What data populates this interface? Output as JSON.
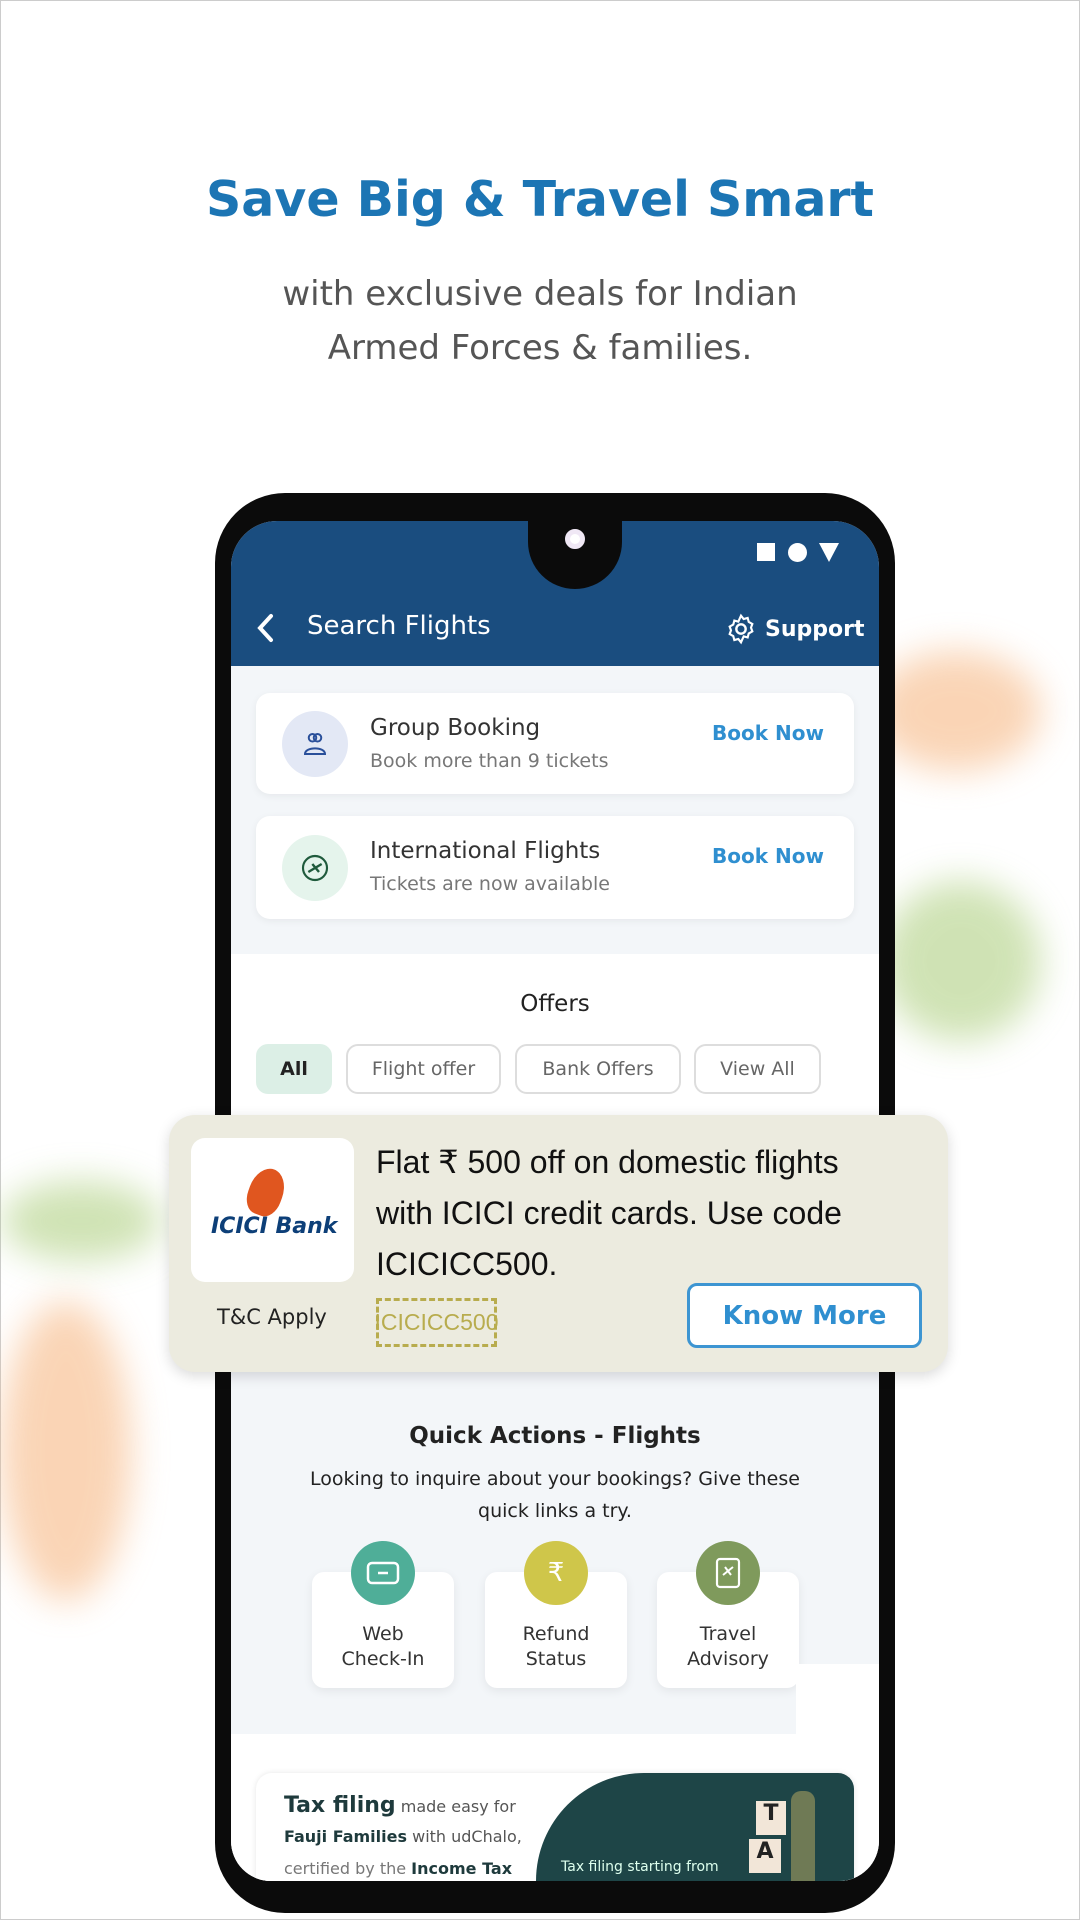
{
  "hero": {
    "title": "Save Big & Travel Smart",
    "subtitle_line1": "with exclusive deals for Indian",
    "subtitle_line2": "Armed Forces & families."
  },
  "colors": {
    "accent": "#1c75b4",
    "header": "#1a4d7f",
    "link": "#2f8fd0",
    "offer_bg": "#ecebdf",
    "code": "#b8ac4e"
  },
  "header": {
    "back_icon": "chevron-left-icon",
    "title": "Search Flights",
    "support_icon": "gear-icon",
    "support_label": "Support"
  },
  "services": [
    {
      "icon": "group-icon",
      "title": "Group Booking",
      "subtitle": "Book more than 9 tickets",
      "action": "Book Now"
    },
    {
      "icon": "globe-plane-icon",
      "title": "International Flights",
      "subtitle": "Tickets are now available",
      "action": "Book Now"
    }
  ],
  "offers": {
    "title": "Offers",
    "chips": [
      "All",
      "Flight offer",
      "Bank Offers",
      "View All"
    ],
    "selected": "All"
  },
  "offer_card": {
    "logo": "ICICI Bank",
    "line1": "Flat ₹ 500 off on domestic flights",
    "line2": "with ICICI credit cards. Use code",
    "line3": "ICICICC500.",
    "terms": "T&C Apply",
    "code": "ICICICC500",
    "button": "Know More"
  },
  "quick_actions": {
    "title": "Quick Actions - Flights",
    "subtitle_line1": "Looking to inquire about your bookings? Give these",
    "subtitle_line2": "quick links a try.",
    "items": [
      {
        "icon": "ticket-icon",
        "line1": "Web",
        "line2": "Check-In",
        "color": "#4fae98"
      },
      {
        "icon": "rupee-icon",
        "line1": "Refund",
        "line2": "Status",
        "color": "#cfc64a"
      },
      {
        "icon": "passport-plane-icon",
        "line1": "Travel",
        "line2": "Advisory",
        "color": "#7f9a5c"
      }
    ]
  },
  "tax_banner": {
    "bold1": "Tax filing",
    "text1": " made easy for",
    "bold2": "Fauji Families",
    "text2": " with udChalo,",
    "text3": "certified by the ",
    "bold3": "Income Tax",
    "right_text": "Tax filing starting from",
    "blocks": [
      "T",
      "A"
    ]
  }
}
